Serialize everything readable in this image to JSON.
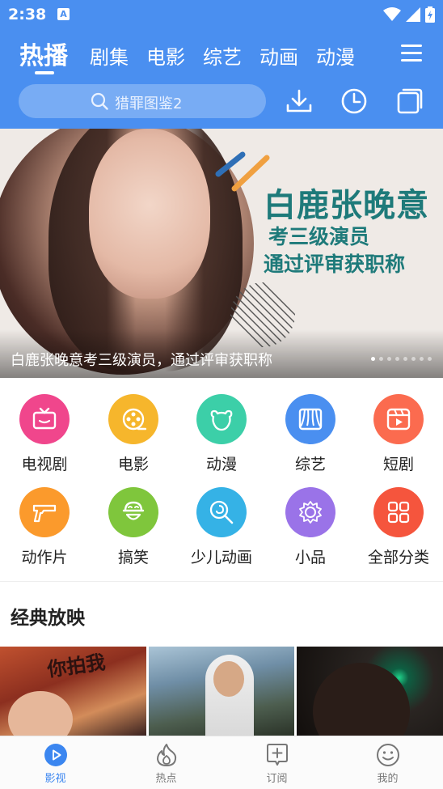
{
  "status_bar": {
    "time": "2:38",
    "notification_glyph": "A"
  },
  "tabs": [
    {
      "label": "热播",
      "active": true
    },
    {
      "label": "剧集"
    },
    {
      "label": "电影"
    },
    {
      "label": "综艺"
    },
    {
      "label": "动画"
    },
    {
      "label": "动漫"
    }
  ],
  "search": {
    "placeholder": "猎罪图鉴2"
  },
  "header_icons": [
    "download-icon",
    "history-icon",
    "windows-icon"
  ],
  "banner": {
    "title": "白鹿张晚意",
    "line1": "考三级演员",
    "line2": "通过评审获职称",
    "caption": "白鹿张晚意考三级演员，通过评审获职称",
    "slide_count": 8,
    "active_slide": 1
  },
  "categories": [
    {
      "label": "电视剧",
      "icon": "tv-icon",
      "color": "#f0468c"
    },
    {
      "label": "电影",
      "icon": "film-reel-icon",
      "color": "#f6b62c"
    },
    {
      "label": "动漫",
      "icon": "bear-icon",
      "color": "#3ccfa8"
    },
    {
      "label": "综艺",
      "icon": "curtain-icon",
      "color": "#4a8ff0"
    },
    {
      "label": "短剧",
      "icon": "play-window-icon",
      "color": "#fb6b4f"
    },
    {
      "label": "动作片",
      "icon": "gun-icon",
      "color": "#fb9a2c"
    },
    {
      "label": "搞笑",
      "icon": "laugh-face-icon",
      "color": "#7fc63c"
    },
    {
      "label": "少儿动画",
      "icon": "lollipop-icon",
      "color": "#35b2e6"
    },
    {
      "label": "小品",
      "icon": "lion-icon",
      "color": "#9a73e8"
    },
    {
      "label": "全部分类",
      "icon": "grid-icon",
      "color": "#f5553d"
    }
  ],
  "section": {
    "title": "经典放映"
  },
  "posters": [
    {
      "overlay_text": "你拍我"
    },
    {
      "overlay_text": ""
    },
    {
      "overlay_text": ""
    }
  ],
  "bottom_nav": [
    {
      "label": "影视",
      "icon": "play-circle-icon",
      "active": true
    },
    {
      "label": "热点",
      "icon": "flame-icon"
    },
    {
      "label": "订阅",
      "icon": "subscribe-plus-icon"
    },
    {
      "label": "我的",
      "icon": "smile-icon"
    }
  ],
  "colors": {
    "primary": "#4a8ff0",
    "banner_text": "#1e7a7a",
    "nav_active": "#3b86f0"
  }
}
